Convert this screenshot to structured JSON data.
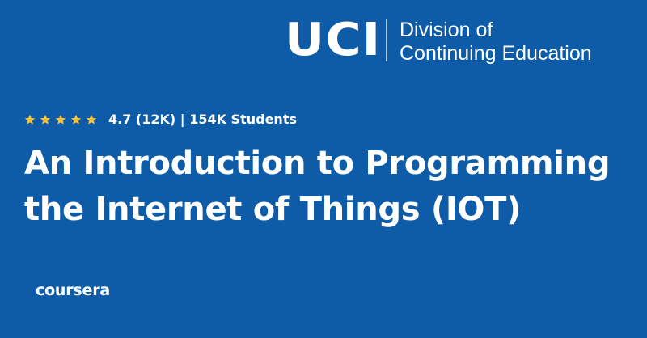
{
  "banner": {
    "background_color": "#0e5ba7",
    "star_color": "#f5c242",
    "logo": {
      "mark": "UCI",
      "line1": "Division of",
      "line2": "Continuing Education"
    },
    "rating": {
      "stars": 5,
      "text": "4.7 (12K) | 154K Students"
    },
    "title": {
      "line1": "An Introduction to Programming",
      "line2": "the Internet of Things (IOT)"
    },
    "provider": "coursera"
  }
}
